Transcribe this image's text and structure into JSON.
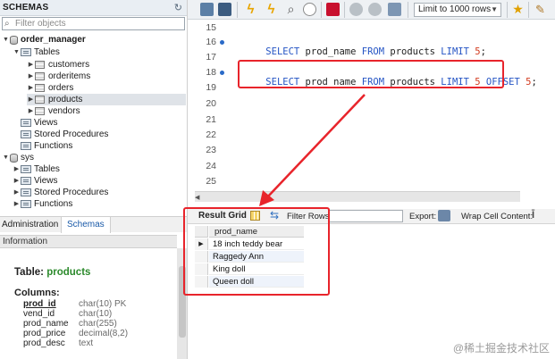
{
  "navigator": {
    "title": "SCHEMAS",
    "filter_placeholder": "Filter objects",
    "tree": {
      "db1": "order_manager",
      "db1_tables": "Tables",
      "tables": [
        "customers",
        "orderitems",
        "orders",
        "products",
        "vendors"
      ],
      "db1_views": "Views",
      "db1_procs": "Stored Procedures",
      "db1_funcs": "Functions",
      "db2": "sys",
      "db2_tables": "Tables",
      "db2_views": "Views",
      "db2_procs": "Stored Procedures",
      "db2_funcs": "Functions"
    },
    "tabs": {
      "administration": "Administration",
      "schemas": "Schemas"
    }
  },
  "info": {
    "header": "Information",
    "table_prefix": "Table: ",
    "table_name": "products",
    "columns_label": "Columns:",
    "columns": [
      {
        "name": "prod_id",
        "type": "char(10) PK"
      },
      {
        "name": "vend_id",
        "type": "char(10)"
      },
      {
        "name": "prod_name",
        "type": "char(255)"
      },
      {
        "name": "prod_price",
        "type": "decimal(8,2)"
      },
      {
        "name": "prod_desc",
        "type": "text"
      }
    ]
  },
  "toolbar": {
    "limit_label": "Limit to 1000 rows"
  },
  "editor": {
    "line_numbers": [
      "15",
      "16",
      "17",
      "18",
      "19",
      "20",
      "21",
      "22",
      "23",
      "24",
      "25"
    ],
    "line16": {
      "select": "SELECT",
      "col": " prod_name ",
      "from": "FROM",
      "tbl": " products ",
      "limit": "LIMIT",
      "n": " 5",
      "end": ";"
    },
    "line18": {
      "select": "SELECT",
      "col": " prod_name ",
      "from": "FROM",
      "tbl": " products ",
      "limit": "LIMIT",
      "n": " 5 ",
      "offset": "OFFSET",
      "n2": " 5",
      "end": ";"
    }
  },
  "result": {
    "tab_label": "Result Grid",
    "filter_label": "Filter Rows:",
    "filter_value": "",
    "export_label": "Export:",
    "wrap_label": "Wrap Cell Content:",
    "column_header": "prod_name",
    "rows": [
      "18 inch teddy bear",
      "Raggedy Ann",
      "King doll",
      "Queen doll"
    ]
  },
  "watermark": "@稀土掘金技术社区",
  "colors": {
    "keyword": "#2454c4",
    "number": "#d23a1e",
    "annotation": "#e8242b"
  }
}
